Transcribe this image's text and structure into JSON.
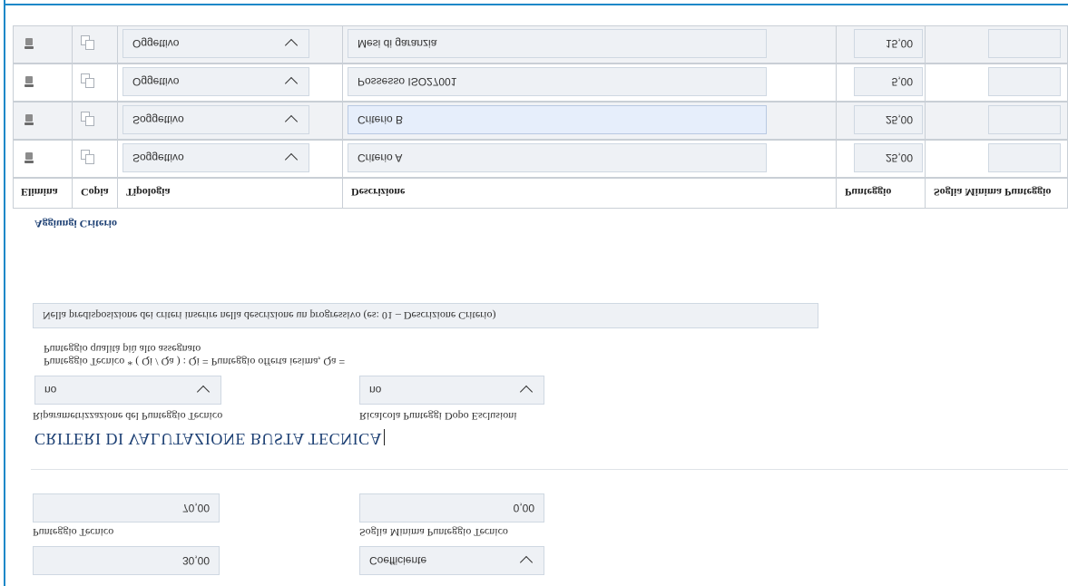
{
  "fields_bottom": {
    "top_left_value": "30,00",
    "coefficiente_label": "Coefficiente",
    "punteggio_tecnico_label": "Punteggio Tecnico",
    "punteggio_tecnico_value": "70,00",
    "soglia_minima_label": "Soglia Minima Punteggio Tecnico",
    "soglia_minima_value": "0,00"
  },
  "section": {
    "title": "CRITERI DI VALUTAZIONE BUSTA TECNICA",
    "riparametrizzazione_label": "Riparametrizzazione del Punteggio Tecnico",
    "riparametrizzazione_value": "no",
    "ricalcola_label": "Ricalcola Punteggi Dopo Esclusioni",
    "ricalcola_value": "no",
    "formula_line1": "Punteggio Tecnico * ( Qi / Qa ) : Qi = Punteggio offerta iesima, Qa =",
    "formula_line2": "Punteggio qualità più alto assegnato",
    "note": "Nella predisposizione dei criteri inserire nella descrizione un progressivo (es: 01 – Descrizione Criterio)",
    "add_link": "Aggiungi Criterio"
  },
  "table": {
    "headers": [
      "Elimina",
      "Copia",
      "Tipologia",
      "Descrizione",
      "Punteggio",
      "Soglia Minima Punteggio"
    ],
    "rows": [
      {
        "tipologia": "Soggettivo",
        "descrizione": "Criterio A",
        "punteggio": "25,00"
      },
      {
        "tipologia": "Soggettivo",
        "descrizione": "Criterio B",
        "punteggio": "25,00"
      },
      {
        "tipologia": "Oggettivo",
        "descrizione": "Possesso ISO27001",
        "punteggio": "5,00"
      },
      {
        "tipologia": "Oggettivo",
        "descrizione": "Mesi di garanzia",
        "punteggio": "15,00"
      }
    ]
  },
  "icons": {
    "delete": "trash-icon",
    "copy": "copy-icon",
    "dropdown": "chevron-icon"
  },
  "colors": {
    "frame": "#1e88c8",
    "title": "#1c3f73",
    "field_bg": "#eef1f5"
  }
}
